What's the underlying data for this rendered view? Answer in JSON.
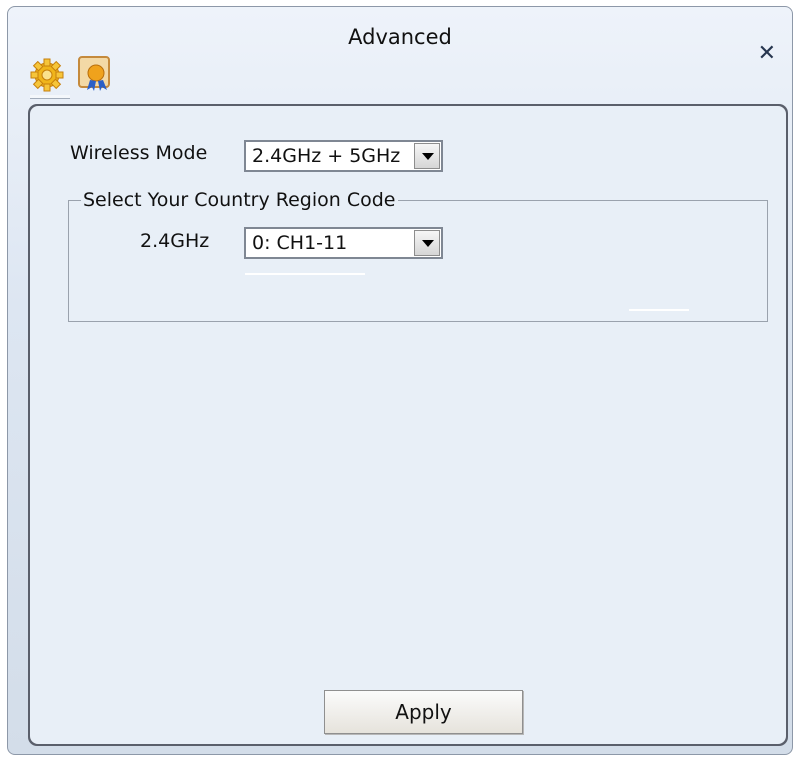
{
  "window": {
    "title": "Advanced",
    "close_glyph": "✕"
  },
  "tabs": [
    {
      "icon": "gear-icon",
      "active": true
    },
    {
      "icon": "certificate-icon",
      "active": false
    }
  ],
  "settings": {
    "wireless_mode": {
      "label": "Wireless Mode",
      "value": "2.4GHz + 5GHz"
    },
    "country_region": {
      "group_label": "Select Your Country Region Code",
      "band_label": "2.4GHz",
      "value": "0: CH1-11"
    }
  },
  "actions": {
    "apply_label": "Apply"
  },
  "colors": {
    "accent": "#d8e2ee",
    "panel": "#e8eff7"
  }
}
